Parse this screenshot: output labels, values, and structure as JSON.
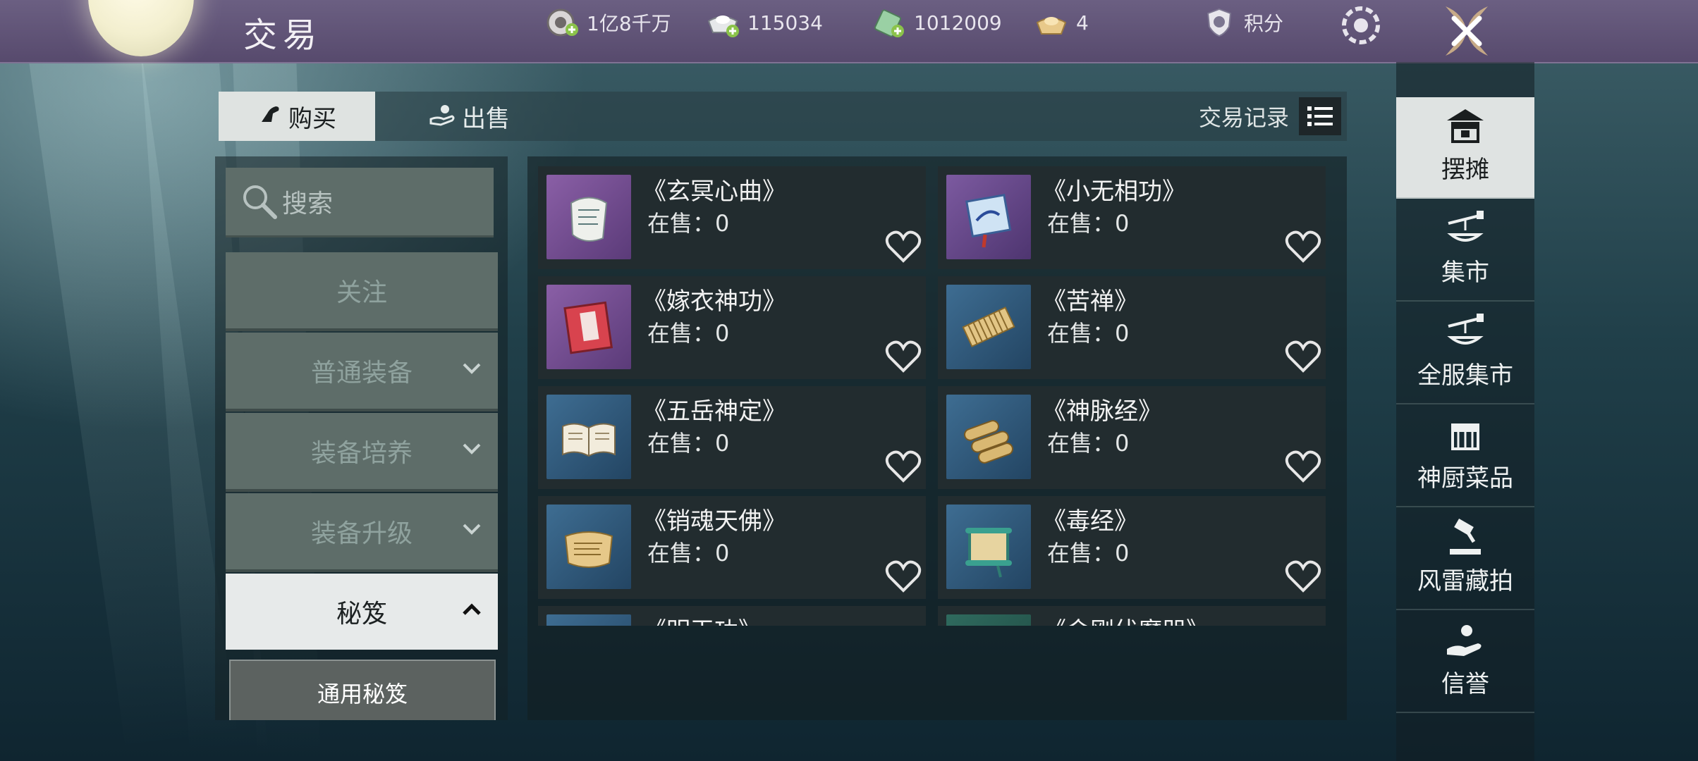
{
  "header": {
    "title": "交易",
    "currencies": [
      {
        "icon": "silver-coin-add-icon",
        "value": "1亿8千万"
      },
      {
        "icon": "ingot-add-icon",
        "value": "115034"
      },
      {
        "icon": "jade-ticket-add-icon",
        "value": "1012009"
      },
      {
        "icon": "gold-ingot-icon",
        "value": "4"
      }
    ],
    "points_label": "积分"
  },
  "tabs": {
    "buy": "购买",
    "sell": "出售",
    "trade_log": "交易记录"
  },
  "categories": {
    "search": "搜索",
    "items": [
      {
        "label": "关注",
        "expandable": false
      },
      {
        "label": "普通装备",
        "expandable": true
      },
      {
        "label": "装备培养",
        "expandable": true
      },
      {
        "label": "装备升级",
        "expandable": true
      },
      {
        "label": "秘笈",
        "expandable": true,
        "expanded": true
      }
    ],
    "subcategory": "通用秘笈"
  },
  "listings": [
    {
      "name": "《玄冥心曲》",
      "stock": "在售：0",
      "icon": "sheet-music-scroll-icon"
    },
    {
      "name": "《小无相功》",
      "stock": "在售：0",
      "icon": "painted-scroll-icon"
    },
    {
      "name": "《嫁衣神功》",
      "stock": "在售：0",
      "icon": "red-book-icon"
    },
    {
      "name": "《苦禅》",
      "stock": "在售：0",
      "icon": "bamboo-slips-icon"
    },
    {
      "name": "《五岳神定》",
      "stock": "在售：0",
      "icon": "open-book-icon"
    },
    {
      "name": "《神脉经》",
      "stock": "在售：0",
      "icon": "rolled-scrolls-icon"
    },
    {
      "name": "《销魂天佛》",
      "stock": "在售：0",
      "icon": "parchment-scroll-icon"
    },
    {
      "name": "《毒经》",
      "stock": "在售：0",
      "icon": "green-scroll-icon"
    },
    {
      "name": "《明玉功》",
      "stock": "",
      "icon": "scroll-icon"
    },
    {
      "name": "《金刚伏魔咒》",
      "stock": "",
      "icon": "scroll-icon"
    }
  ],
  "sidebar": {
    "items": [
      {
        "label": "摆摊",
        "icon": "stall-icon",
        "active": true
      },
      {
        "label": "集市",
        "icon": "scale-icon"
      },
      {
        "label": "全服集市",
        "icon": "scale-icon"
      },
      {
        "label": "神厨菜品",
        "icon": "shop-icon"
      },
      {
        "label": "风雷藏拍",
        "icon": "gavel-icon"
      },
      {
        "label": "信誉",
        "icon": "hand-icon"
      }
    ]
  },
  "colors": {
    "topbar": "#574a6d",
    "active_tab": "#dfe3e1",
    "category_bg": "#5e6d69",
    "card_bg": "#222c2f"
  }
}
